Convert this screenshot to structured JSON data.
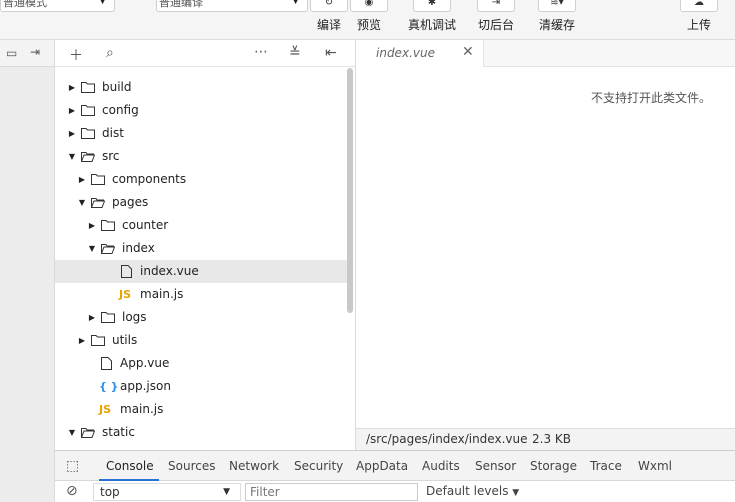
{
  "toolbar": {
    "mode_select": "普通模式",
    "compile_select": "普通编译",
    "buttons": [
      {
        "label": "编译"
      },
      {
        "label": "预览"
      },
      {
        "label": "真机调试"
      },
      {
        "label": "切后台"
      },
      {
        "label": "清缓存"
      },
      {
        "label": "上传"
      }
    ]
  },
  "explorer": {
    "tree": [
      {
        "name": "build",
        "type": "folder",
        "open": false
      },
      {
        "name": "config",
        "type": "folder",
        "open": false
      },
      {
        "name": "dist",
        "type": "folder",
        "open": false
      },
      {
        "name": "src",
        "type": "folder",
        "open": true
      },
      {
        "name": "components",
        "type": "folder",
        "open": false
      },
      {
        "name": "pages",
        "type": "folder",
        "open": true
      },
      {
        "name": "counter",
        "type": "folder",
        "open": false
      },
      {
        "name": "index",
        "type": "folder",
        "open": true
      },
      {
        "name": "index.vue",
        "type": "file"
      },
      {
        "name": "main.js",
        "type": "js"
      },
      {
        "name": "logs",
        "type": "folder",
        "open": false
      },
      {
        "name": "utils",
        "type": "folder",
        "open": false
      },
      {
        "name": "App.vue",
        "type": "file"
      },
      {
        "name": "app.json",
        "type": "json"
      },
      {
        "name": "main.js",
        "type": "js"
      },
      {
        "name": "static",
        "type": "folder",
        "open": true
      }
    ]
  },
  "editor": {
    "tab_title": "index.vue",
    "message": "不支持打开此类文件。",
    "status_path": "/src/pages/index/index.vue",
    "status_size": "2.3 KB"
  },
  "devtools": {
    "tabs": [
      "Console",
      "Sources",
      "Network",
      "Security",
      "AppData",
      "Audits",
      "Sensor",
      "Storage",
      "Trace",
      "Wxml"
    ],
    "context": "top",
    "filter_placeholder": "Filter",
    "levels": "Default levels"
  }
}
